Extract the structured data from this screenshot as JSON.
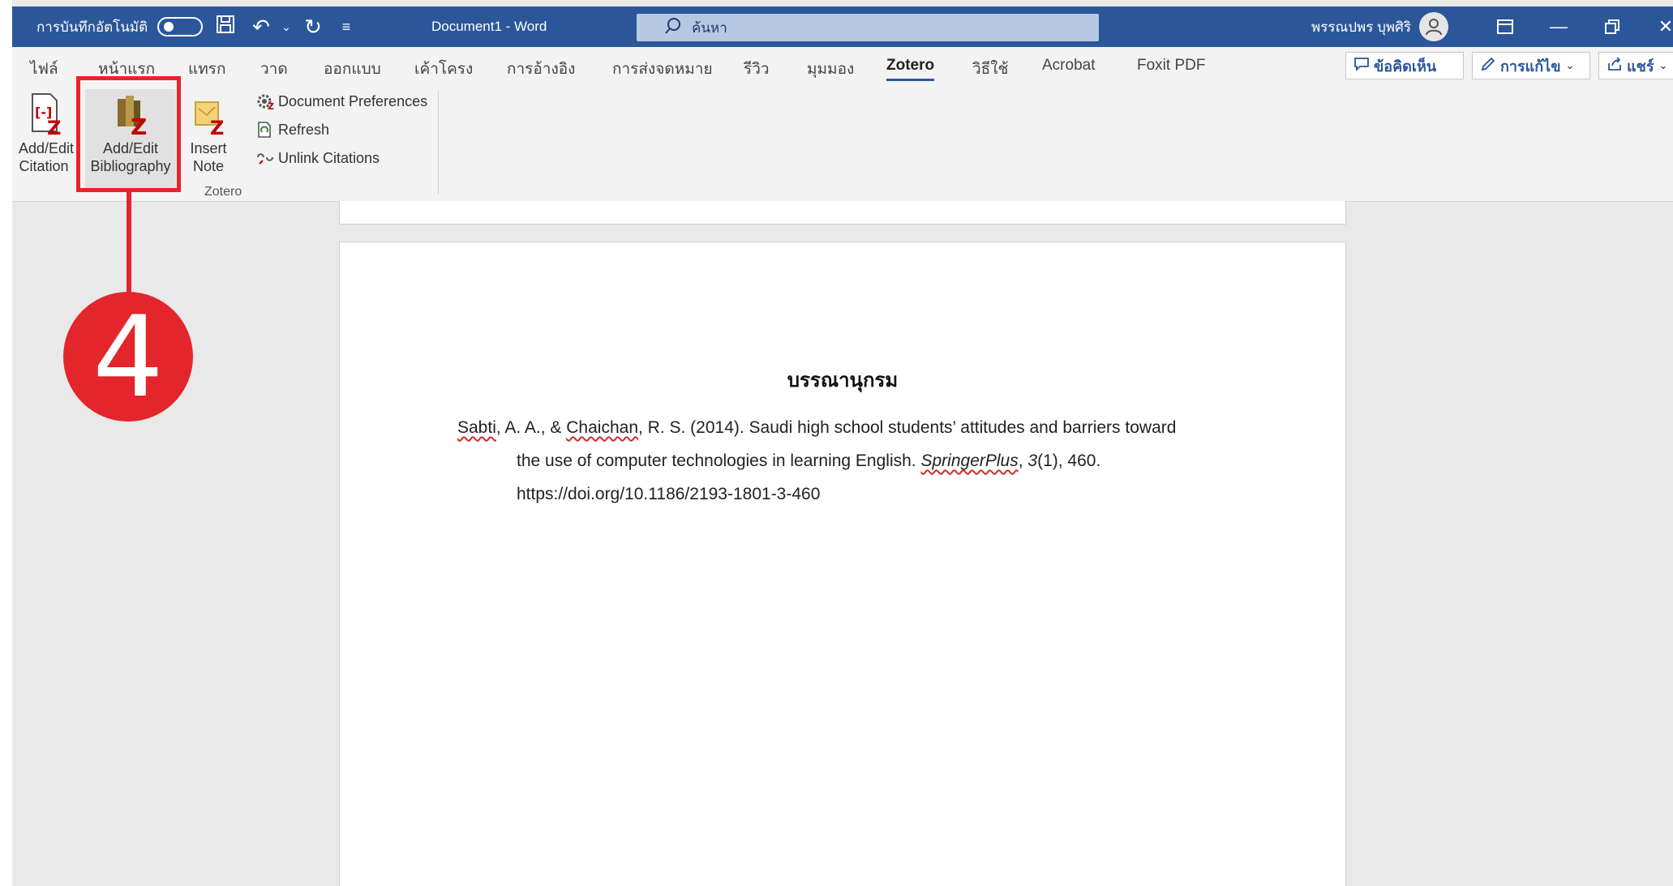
{
  "titlebar": {
    "autosave_label": "การบันทึกอัตโนมัติ",
    "doc_title": "Document1  -  Word",
    "search_placeholder": "ค้นหา",
    "user_name": "พรรณปพร บุพศิริ"
  },
  "tabs": [
    "ไฟล์",
    "หน้าแรก",
    "แทรก",
    "วาด",
    "ออกแบบ",
    "เค้าโครง",
    "การอ้างอิง",
    "การส่งจดหมาย",
    "รีวิว",
    "มุมมอง",
    "Zotero",
    "วิธีใช้",
    "Acrobat",
    "Foxit PDF"
  ],
  "active_tab": "Zotero",
  "ribbon_right": {
    "comments": "ข้อคิดเห็น",
    "editing": "การแก้ไข",
    "share": "แชร์"
  },
  "zotero_group": {
    "add_edit_citation": [
      "Add/Edit",
      "Citation"
    ],
    "add_edit_bibliography": [
      "Add/Edit",
      "Bibliography"
    ],
    "insert_note": [
      "Insert",
      "Note"
    ],
    "document_preferences": "Document Preferences",
    "refresh": "Refresh",
    "unlink_citations": "Unlink Citations",
    "group_label": "Zotero"
  },
  "document": {
    "heading": "บรรณานุกรม",
    "reference": {
      "author1": "Sabti",
      "mid1": ", A. A., & ",
      "author2": "Chaichan",
      "mid2": ", R. S. (2014). Saudi high school students’ attitudes and barriers toward",
      "line2_pre": "the use of computer technologies in learning English. ",
      "journal": "SpringerPlus",
      "line2_mid": ", ",
      "volume": "3",
      "line2_post": "(1), 460.",
      "doi": "https://doi.org/10.1186/2193-1801-3-460"
    }
  },
  "annotation": {
    "step_number": "4",
    "color": "#e3262b"
  },
  "colors": {
    "titlebar": "#2b579a",
    "ribbon": "#f3f3f3"
  }
}
